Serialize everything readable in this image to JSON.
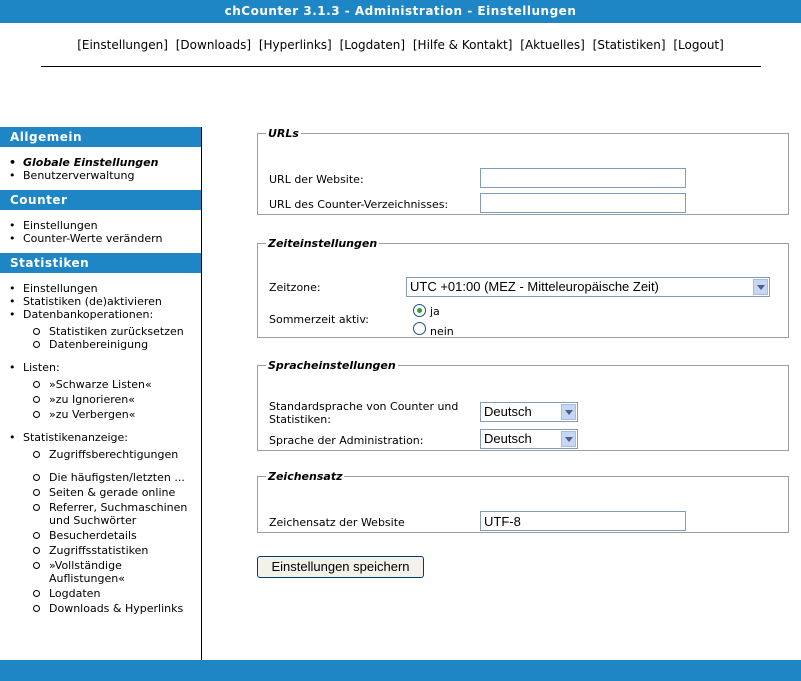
{
  "title": "chCounter 3.1.3 - Administration - Einstellungen",
  "topnav": [
    "[Einstellungen]",
    "[Downloads]",
    "[Hyperlinks]",
    "[Logdaten]",
    "[Hilfe & Kontakt]",
    "[Aktuelles]",
    "[Statistiken]",
    "[Logout]"
  ],
  "sidebar": {
    "allgemein": {
      "heading": "Allgemein",
      "items": [
        "Globale Einstellungen",
        "Benutzerverwaltung"
      ]
    },
    "counter": {
      "heading": "Counter",
      "items": [
        "Einstellungen",
        "Counter-Werte verändern"
      ]
    },
    "statistiken": {
      "heading": "Statistiken",
      "items": [
        "Einstellungen",
        "Statistiken (de)aktivieren",
        "Datenbankoperationen:"
      ],
      "db_sub": [
        "Statistiken zurücksetzen",
        "Datenbereinigung"
      ],
      "listen": "Listen:",
      "listen_sub": [
        "»Schwarze Listen«",
        "»zu Ignorieren«",
        "»zu Verbergen«"
      ],
      "anzeige": "Statistikenanzeige:",
      "anzeige_sub": [
        "Zugriffsberechtigungen",
        "Die häufigsten/letzten ...",
        "Seiten & gerade online",
        "Referrer, Suchmaschinen und Suchwörter",
        "Besucherdetails",
        "Zugriffsstatistiken",
        "»Vollständige Auflistungen«",
        "Logdaten",
        "Downloads & Hyperlinks"
      ]
    }
  },
  "urls": {
    "legend": "URLs",
    "website_label": "URL der Website:",
    "website_value": "",
    "dir_label": "URL des Counter-Verzeichnisses:",
    "dir_value": ""
  },
  "zeit": {
    "legend": "Zeiteinstellungen",
    "zone_label": "Zeitzone:",
    "zone_value": "UTC +01:00 (MEZ - Mitteleuropäische Zeit)",
    "dst_label": "Sommerzeit aktiv:",
    "opt_ja": "ja",
    "opt_nein": "nein",
    "selected": "ja"
  },
  "sprache": {
    "legend": "Spracheinstellungen",
    "std_label": "Standardsprache von Counter und Statistiken:",
    "std_value": "Deutsch",
    "admin_label": "Sprache der Administration:",
    "admin_value": "Deutsch"
  },
  "zeichensatz": {
    "legend": "Zeichensatz",
    "label": "Zeichensatz der Website",
    "value": "UTF-8"
  },
  "save_label": "Einstellungen speichern"
}
